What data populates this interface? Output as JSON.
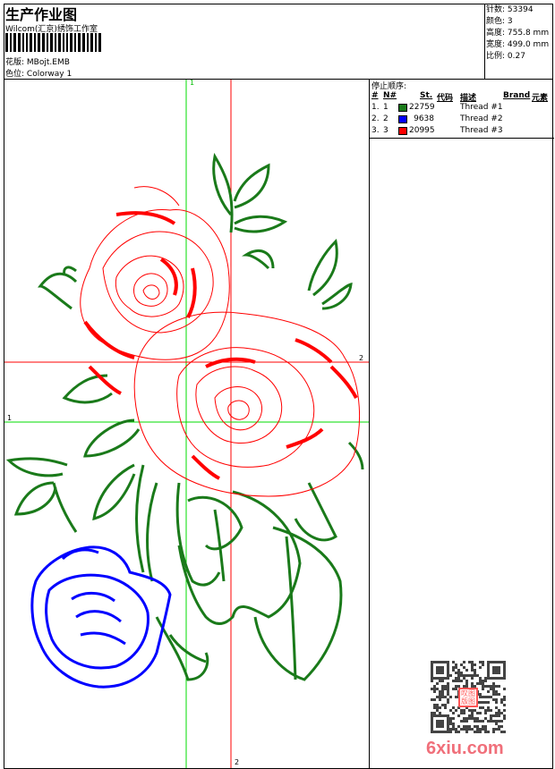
{
  "header": {
    "title": "生产作业图",
    "company": "Wilcom(汇京)绣饰工作室",
    "design_label": "花版:",
    "design_value": "MBojt.EMB",
    "colorway_label": "色位:",
    "colorway_value": "Colorway 1"
  },
  "stats": [
    {
      "label": "针数:",
      "value": "53394"
    },
    {
      "label": "颜色:",
      "value": "3"
    },
    {
      "label": "高度:",
      "value": "755.8 mm"
    },
    {
      "label": "宽度:",
      "value": "499.0 mm"
    },
    {
      "label": "比例:",
      "value": "0.27"
    }
  ],
  "stop_sequence": {
    "title": "停止顺序:",
    "headers": {
      "num": "#",
      "n": "N#",
      "st": "St.",
      "code": "代码",
      "desc": "描述",
      "brand": "Brand",
      "element": "元素"
    },
    "rows": [
      {
        "num": "1.",
        "n": "1",
        "color": "#1a7a1a",
        "st": "22759",
        "desc": "Thread #1"
      },
      {
        "num": "2.",
        "n": "2",
        "color": "#0000ff",
        "st": "9638",
        "desc": "Thread #2"
      },
      {
        "num": "3.",
        "n": "3",
        "color": "#ff0000",
        "st": "20995",
        "desc": "Thread #3"
      }
    ]
  },
  "guides": {
    "v1": "1",
    "h2": "2",
    "h1": "1",
    "v2": "2"
  },
  "watermark": {
    "text": "6xiu.com",
    "stamp": "叹图版图"
  },
  "colors": {
    "green": "#1a7a1a",
    "blue": "#0000ff",
    "red": "#ff0000",
    "guide_green": "#00dd00"
  }
}
